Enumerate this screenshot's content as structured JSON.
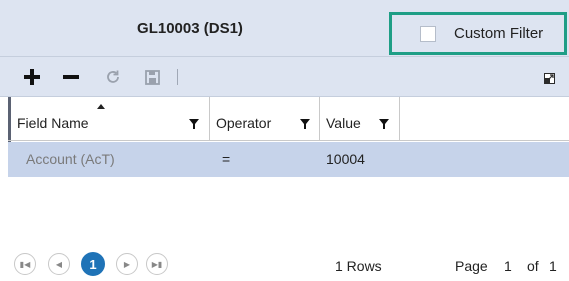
{
  "header": {
    "title": "GL10003 (DS1)",
    "custom_filter_label": "Custom Filter",
    "custom_filter_checked": false
  },
  "toolbar": {
    "icons": [
      "plus-icon",
      "minus-icon",
      "refresh-icon",
      "save-icon",
      "expand-icon"
    ]
  },
  "grid": {
    "columns": [
      "Field Name",
      "Operator",
      "Value"
    ],
    "sorted_column": "Field Name",
    "rows": [
      {
        "field_name": "Account (AcT)",
        "operator": "=",
        "value": "10004"
      }
    ]
  },
  "pager": {
    "current_page": "1",
    "rows_text": "1 Rows",
    "page_label": "Page",
    "page_number": "1",
    "of_label": "of",
    "total_pages": "1"
  },
  "colors": {
    "header_bg": "#dde4f1",
    "selected_row_bg": "#c6d3ea",
    "custom_filter_border": "#1e9e86",
    "active_page": "#1f73b7"
  }
}
